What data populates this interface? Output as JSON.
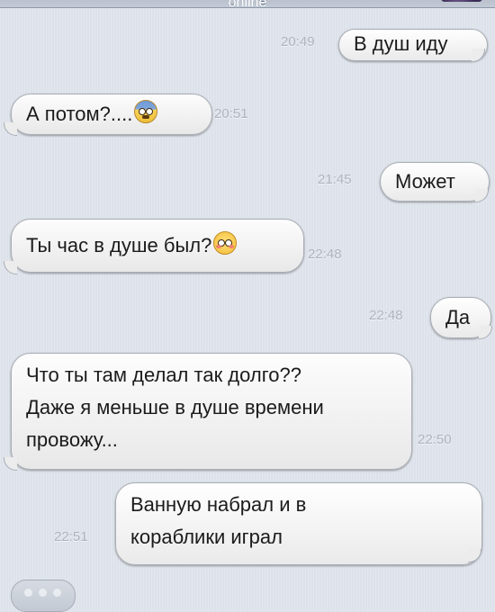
{
  "header": {
    "status": "online"
  },
  "messages": [
    {
      "id": 1,
      "direction": "outgoing",
      "text": "В душ иду",
      "time": "20:49"
    },
    {
      "id": 2,
      "direction": "incoming",
      "text": "А потом?....",
      "emoji": "fearful-face",
      "time": "20:51"
    },
    {
      "id": 3,
      "direction": "outgoing",
      "text": "Может",
      "time": "21:45"
    },
    {
      "id": 4,
      "direction": "incoming",
      "text": "Ты час в душе был?",
      "emoji": "flushed-face",
      "time": "22:48"
    },
    {
      "id": 5,
      "direction": "outgoing",
      "text": "Да",
      "time": "22:48"
    },
    {
      "id": 6,
      "direction": "incoming",
      "lines": [
        "Что ты там делал так долго??",
        "Даже я меньше в душе времени",
        "провожу..."
      ],
      "time": "22:50"
    },
    {
      "id": 7,
      "direction": "outgoing",
      "lines": [
        "Ванную набрал и в",
        "кораблики играл"
      ],
      "time": "22:51"
    }
  ],
  "colors": {
    "background": "#dde2ea",
    "bubble": "#f4f4f4",
    "timestamp": "#aeb4bf",
    "text": "#1b1b1b"
  }
}
